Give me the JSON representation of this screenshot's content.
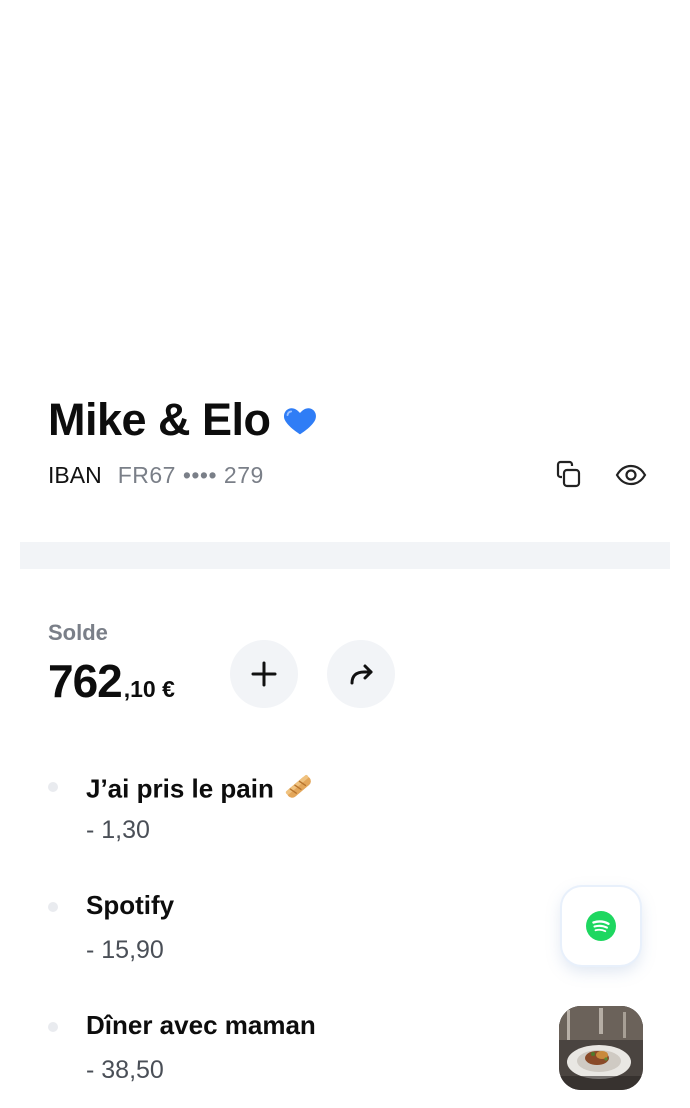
{
  "account": {
    "name": "Mike & Elo",
    "emoji": "blue-heart",
    "iban_label": "IBAN",
    "iban_masked": "FR67 •••• 279"
  },
  "icons": {
    "copy": "copy-icon",
    "visibility": "eye-icon",
    "add": "plus-icon",
    "transfer": "share-arrow-icon"
  },
  "balance": {
    "label": "Solde",
    "main": "762",
    "cents": ",10 €"
  },
  "transactions": [
    {
      "title": "J’ai pris le pain",
      "emoji": "baguette",
      "amount": "- 1,30"
    },
    {
      "title": "Spotify",
      "icon": "spotify-logo",
      "amount": "- 15,90"
    },
    {
      "title": "Dîner avec maman",
      "icon": "dinner-photo",
      "amount": "- 38,50"
    }
  ],
  "colors": {
    "heart": "#2f7df6",
    "spotify": "#1ed760",
    "muted_text": "#7a7f88",
    "surface": "#f2f4f7"
  }
}
